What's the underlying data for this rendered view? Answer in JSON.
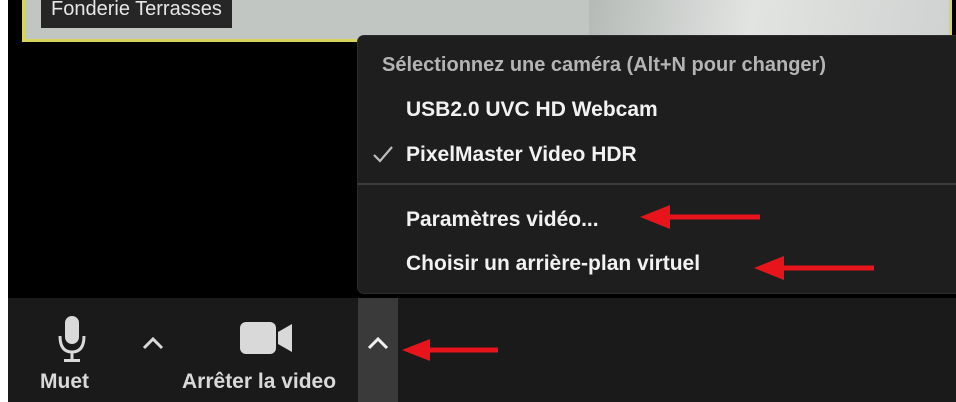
{
  "video": {
    "participant_name": "Fonderie Terrasses"
  },
  "camera_menu": {
    "header": "Sélectionnez une caméra (Alt+N pour changer)",
    "cameras": [
      {
        "label": "USB2.0 UVC HD Webcam",
        "selected": false
      },
      {
        "label": "PixelMaster Video HDR",
        "selected": true
      }
    ],
    "video_settings_label": "Paramètres vidéo...",
    "virtual_background_label": "Choisir un arrière-plan virtuel"
  },
  "toolbar": {
    "mute_label": "Muet",
    "stop_video_label": "Arrêter la video"
  },
  "icons": {
    "mute": "microphone-icon",
    "audio_options": "chevron-up-icon",
    "video": "video-camera-icon",
    "video_options": "chevron-up-icon",
    "selected": "checkmark-icon",
    "annotation": "red-arrow-icon"
  },
  "colors": {
    "menu_bg": "#1e1e1e",
    "toolbar_bg": "#1a1a1a",
    "annotation_red": "#e8141c",
    "active_speaker_border": "#d8d35a"
  }
}
